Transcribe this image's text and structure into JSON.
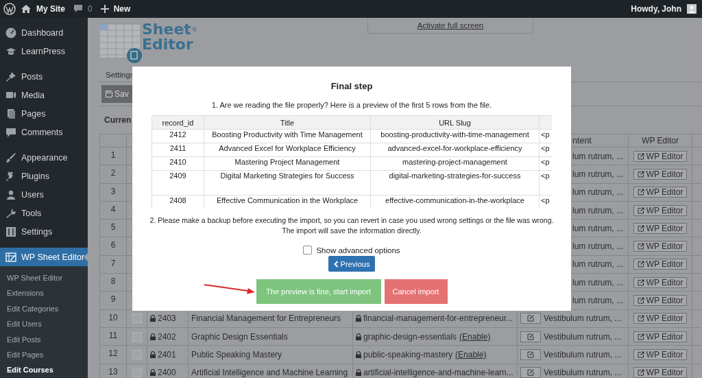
{
  "admin_bar": {
    "site": "My Site",
    "comments": "0",
    "new": "New",
    "greeting": "Howdy, John"
  },
  "sidebar": {
    "sections": [
      {
        "items": [
          {
            "label": "Dashboard",
            "selected": false
          },
          {
            "label": "LearnPress",
            "selected": false
          }
        ]
      },
      {
        "items": [
          {
            "label": "Posts",
            "selected": false
          },
          {
            "label": "Media",
            "selected": false
          },
          {
            "label": "Pages",
            "selected": false
          },
          {
            "label": "Comments",
            "selected": false
          }
        ]
      },
      {
        "items": [
          {
            "label": "Appearance",
            "selected": false
          },
          {
            "label": "Plugins",
            "selected": false
          },
          {
            "label": "Users",
            "selected": false
          },
          {
            "label": "Tools",
            "selected": false
          },
          {
            "label": "Settings",
            "selected": false
          }
        ]
      },
      {
        "items": [
          {
            "label": "WP Sheet Editor",
            "selected": true,
            "children": [
              {
                "label": "WP Sheet Editor",
                "selected": false
              },
              {
                "label": "Extensions",
                "selected": false
              },
              {
                "label": "Edit Categories",
                "selected": false
              },
              {
                "label": "Edit Users",
                "selected": false
              },
              {
                "label": "Edit Posts",
                "selected": false
              },
              {
                "label": "Edit Pages",
                "selected": false
              },
              {
                "label": "Edit Courses",
                "selected": true
              }
            ]
          }
        ]
      }
    ]
  },
  "logo": {
    "line1": "Sheet",
    "line2": "Editor",
    "mark": "®"
  },
  "fullscreen_link": "Activate full screen",
  "tab": "Settings",
  "save_button": "Sav",
  "current": "Curren",
  "sheet": {
    "columns": {
      "content": "ntent",
      "editor": "WP Editor"
    },
    "rows": [
      {
        "kind": "covered",
        "number": "1",
        "content": "lum rutrum, ...",
        "editor": "WP Editor"
      },
      {
        "kind": "covered",
        "number": "2",
        "content": "lum rutrum, ...",
        "editor": "WP Editor"
      },
      {
        "kind": "covered",
        "number": "3",
        "content": "lum rutrum, ...",
        "editor": "WP Editor"
      },
      {
        "kind": "covered",
        "number": "4",
        "content": "lum rutrum, ...",
        "editor": "WP Editor"
      },
      {
        "kind": "covered",
        "number": "5",
        "content": "lum rutrum, ...",
        "editor": "WP Editor"
      },
      {
        "kind": "covered",
        "number": "6",
        "content": "lum rutrum, ...",
        "editor": "WP Editor"
      },
      {
        "kind": "covered",
        "number": "7",
        "content": "lum rutrum, ...",
        "editor": "WP Editor"
      },
      {
        "kind": "covered",
        "number": "8",
        "content": "lum rutrum, ...",
        "editor": "WP Editor"
      },
      {
        "kind": "covered",
        "number": "9",
        "content": "lum rutrum, ...",
        "editor": "WP Editor"
      },
      {
        "kind": "full",
        "number": "10",
        "checked": false,
        "id": "2403",
        "title": "Financial Management for Entrepreneurs",
        "slug": "financial-management-for-entrepreneur...",
        "content": "Vestibulum rutrum, ...",
        "editor": "WP Editor"
      },
      {
        "kind": "full",
        "number": "11",
        "checked": false,
        "id": "2402",
        "title": "Graphic Design Essentials",
        "slug": "graphic-design-essentials",
        "slug_link": "(Enable)",
        "content": "Vestibulum rutrum, ...",
        "editor": "WP Editor"
      },
      {
        "kind": "full",
        "number": "12",
        "checked": false,
        "id": "2401",
        "title": "Public Speaking Mastery",
        "slug": "public-speaking-mastery",
        "slug_link": "(Enable)",
        "content": "Vestibulum rutrum, ...",
        "editor": "WP Editor"
      },
      {
        "kind": "full",
        "number": "13",
        "checked": false,
        "id": "2400",
        "title": "Artificial Intelligence and Machine Learning",
        "slug": "artificial-intelligence-and-machine-learn...",
        "content": "Vestibulum rutrum, ...",
        "editor": "WP Editor"
      }
    ]
  },
  "modal": {
    "title": "Final step",
    "intro": "1. Are we reading the file properly? Here is a preview of the first 5 rows from the file.",
    "preview": {
      "columns": [
        "record_id",
        "Title",
        "URL Slug"
      ],
      "rows": [
        {
          "record_id": "2412",
          "title": "Boosting Productivity with Time Management",
          "slug": "boosting-productivity-with-time-management",
          "column_4": "<p"
        },
        {
          "record_id": "2411",
          "title": "Advanced Excel for Workplace Efficiency",
          "slug": "advanced-excel-for-workplace-efficiency",
          "column_4": "<p"
        },
        {
          "record_id": "2410",
          "title": "Mastering Project Management",
          "slug": "mastering-project-management",
          "column_4": "<p"
        },
        {
          "record_id": "2409",
          "title": "Digital Marketing Strategies for Success",
          "slug": "digital-marketing-strategies-for-success",
          "column_4": "<p"
        },
        {
          "record_id": "2408",
          "title": "Effective Communication in the Workplace",
          "slug": "effective-communication-in-the-workplace",
          "column_4": "<p"
        }
      ]
    },
    "note": "2. Please make a backup before executing the import, so you can revert in case you used wrong settings or the file was wrong. The import will save the information directly.",
    "advanced": {
      "label": "Show advanced options",
      "checked": false
    },
    "previous_button": "Previous",
    "start_button": "The preview is fine, start import",
    "cancel_button": "Cancel import"
  }
}
